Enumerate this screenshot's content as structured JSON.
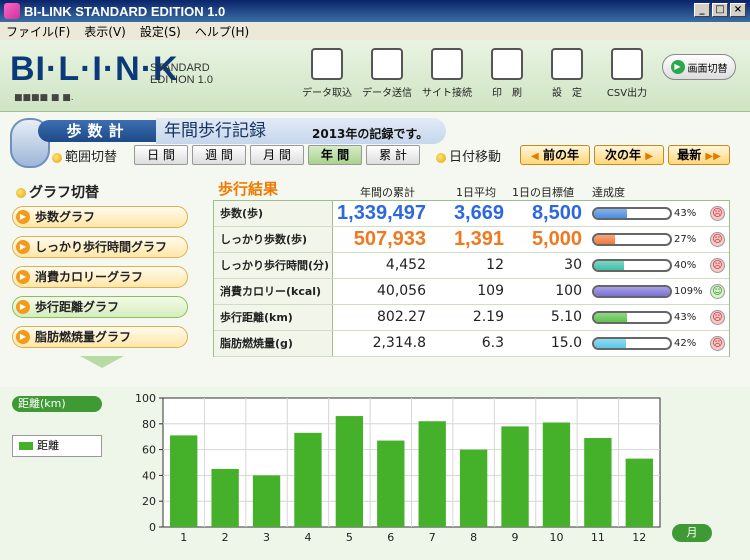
{
  "window": {
    "title": "BI-LINK STANDARD EDITION 1.0",
    "min": "_",
    "max": "□",
    "close": "×"
  },
  "menu": [
    "ファイル(F)",
    "表示(V)",
    "設定(S)",
    "ヘルプ(H)"
  ],
  "header": {
    "logo": "BI·L·I·N·K",
    "edition_line1": "STANDARD",
    "edition_line2": "EDITION 1.0",
    "toolbar": [
      "データ取込",
      "データ送信",
      "サイト接続",
      "印　刷",
      "設　定",
      "CSV出力"
    ],
    "screen_switch": "画面切替"
  },
  "nav": {
    "tab_label": "歩数計",
    "page_title": "年間歩行記録",
    "subtitle": "2013年の記録です。",
    "range_label": "範囲切替",
    "ranges": [
      "日 間",
      "週 間",
      "月 間",
      "年 間",
      "累 計"
    ],
    "active_range": "年 間",
    "date_move_label": "日付移動",
    "prev_year": "前の年",
    "next_year": "次の年",
    "latest": "最新"
  },
  "sidebar": {
    "title": "グラフ切替",
    "buttons": [
      "歩数グラフ",
      "しっかり歩行時間グラフ",
      "消費カロリーグラフ",
      "歩行距離グラフ",
      "脂肪燃焼量グラフ"
    ],
    "active": "歩行距離グラフ"
  },
  "results": {
    "title": "歩行結果",
    "col_total": "年間の累計",
    "col_avg": "1日平均",
    "col_target": "1日の目標値",
    "col_achieve": "達成度",
    "rows": [
      {
        "label": "歩数(歩)",
        "total": "1,339,497",
        "avg": "3,669",
        "target": "8,500",
        "pct": "43%",
        "pct_value": 43,
        "color": "#4a8de0",
        "style": "blue",
        "face": "sad"
      },
      {
        "label": "しっかり歩数(歩)",
        "total": "507,933",
        "avg": "1,391",
        "target": "5,000",
        "pct": "27%",
        "pct_value": 27,
        "color": "#f07a3c",
        "style": "orange",
        "face": "sad"
      },
      {
        "label": "しっかり歩行時間(分)",
        "total": "4,452",
        "avg": "12",
        "target": "30",
        "pct": "40%",
        "pct_value": 40,
        "color": "#3fbfa8",
        "style": "plain",
        "face": "sad"
      },
      {
        "label": "消費カロリー(kcal)",
        "total": "40,056",
        "avg": "109",
        "target": "100",
        "pct": "109%",
        "pct_value": 100,
        "color": "#7b72d8",
        "style": "plain",
        "face": "happy"
      },
      {
        "label": "歩行距離(km)",
        "total": "802.27",
        "avg": "2.19",
        "target": "5.10",
        "pct": "43%",
        "pct_value": 43,
        "color": "#5cc24a",
        "style": "plain",
        "face": "sad"
      },
      {
        "label": "脂肪燃焼量(g)",
        "total": "2,314.8",
        "avg": "6.3",
        "target": "15.0",
        "pct": "42%",
        "pct_value": 42,
        "color": "#5ac8e8",
        "style": "plain",
        "face": "sad"
      }
    ]
  },
  "chart": {
    "ylabel": "距離(km)",
    "legend": "距離",
    "xlabel": "月",
    "color": "#45b029"
  },
  "chart_data": {
    "type": "bar",
    "categories": [
      "1",
      "2",
      "3",
      "4",
      "5",
      "6",
      "7",
      "8",
      "9",
      "10",
      "11",
      "12"
    ],
    "series": [
      {
        "name": "距離",
        "values": [
          71,
          45,
          40,
          73,
          86,
          67,
          82,
          60,
          78,
          81,
          69,
          53
        ]
      }
    ],
    "ylim": [
      0,
      100
    ],
    "yticks": [
      0,
      20,
      40,
      60,
      80,
      100
    ],
    "grid": true,
    "legend_position": "left"
  }
}
